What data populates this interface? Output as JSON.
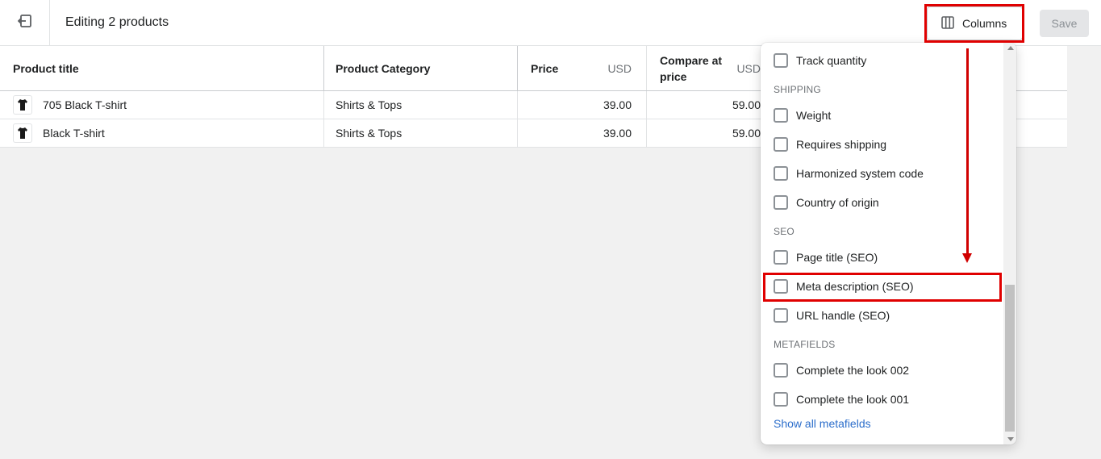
{
  "header": {
    "title": "Editing 2 products",
    "columns_label": "Columns",
    "save_label": "Save"
  },
  "table": {
    "headers": {
      "product_title": "Product title",
      "product_category": "Product Category",
      "price": "Price",
      "price_unit": "USD",
      "compare_at_price": "Compare at price",
      "compare_unit": "USD"
    },
    "rows": [
      {
        "title": "705 Black T-shirt",
        "category": "Shirts & Tops",
        "price": "39.00",
        "compare": "59.00"
      },
      {
        "title": "Black T-shirt",
        "category": "Shirts & Tops",
        "price": "39.00",
        "compare": "59.00"
      }
    ]
  },
  "columns_menu": {
    "track_quantity": "Track quantity",
    "shipping_header": "SHIPPING",
    "weight": "Weight",
    "requires_shipping": "Requires shipping",
    "hs_code": "Harmonized system code",
    "country_of_origin": "Country of origin",
    "seo_header": "SEO",
    "page_title_seo": "Page title (SEO)",
    "meta_description_seo": "Meta description (SEO)",
    "url_handle_seo": "URL handle (SEO)",
    "metafields_header": "METAFIELDS",
    "complete_look_002": "Complete the look 002",
    "complete_look_001": "Complete the look 001",
    "show_all_metafields": "Show all metafields"
  },
  "colors": {
    "highlight": "#e00000",
    "link": "#2c6ecb"
  }
}
